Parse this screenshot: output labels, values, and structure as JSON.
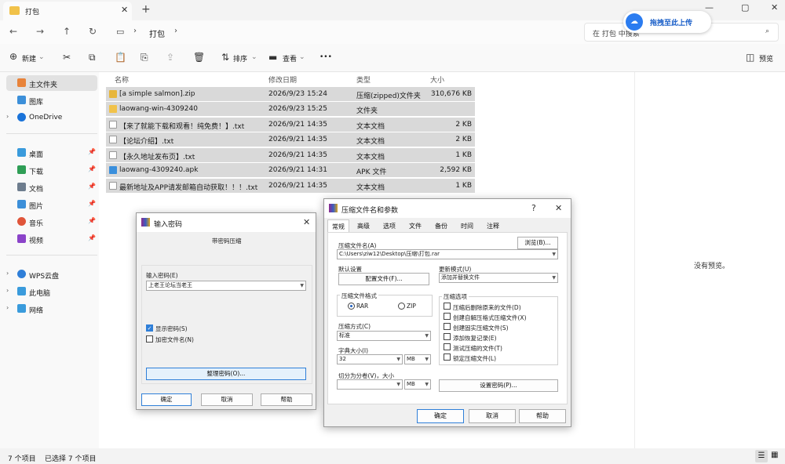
{
  "window": {
    "tab_title": "打包",
    "close_tab": "✕",
    "new_tab": "+",
    "minimize": "—",
    "maximize": "▢",
    "close": "✕"
  },
  "address": {
    "path": "打包",
    "search_placeholder": "在 打包 中搜索"
  },
  "upload": {
    "label": "拖拽至此上传"
  },
  "toolbar": {
    "new": "新建",
    "sort": "排序",
    "view": "查看",
    "more": "•••",
    "preview": "预览"
  },
  "sidebar": {
    "items": [
      {
        "label": "主文件夹",
        "color": "#e8833a"
      },
      {
        "label": "图库",
        "color": "#3c8fd9"
      },
      {
        "label": "OneDrive",
        "color": "#1a73d9"
      },
      {
        "label": "桌面",
        "color": "#3a9bdc"
      },
      {
        "label": "下载",
        "color": "#2f9e56"
      },
      {
        "label": "文档",
        "color": "#6e7d8e"
      },
      {
        "label": "图片",
        "color": "#3c8fd9"
      },
      {
        "label": "音乐",
        "color": "#e0553a"
      },
      {
        "label": "视频",
        "color": "#8b43c9"
      },
      {
        "label": "WPS云盘",
        "color": "#2f7fd8"
      },
      {
        "label": "此电脑",
        "color": "#3a9bdc"
      },
      {
        "label": "网络",
        "color": "#3a9bdc"
      }
    ]
  },
  "columns": {
    "name": "名称",
    "date": "修改日期",
    "type": "类型",
    "size": "大小"
  },
  "files": [
    {
      "name": "[a simple salmon].zip",
      "date": "2026/9/23 15:24",
      "type": "压缩(zipped)文件夹",
      "size": "310,676 KB",
      "color": "#e7b63b"
    },
    {
      "name": "laowang-win-4309240",
      "date": "2026/9/23 15:25",
      "type": "文件夹",
      "size": "",
      "color": "#f1c24a"
    },
    {
      "name": "【来了就能下载和观看！纯免费！】.txt",
      "date": "2026/9/21 14:35",
      "type": "文本文档",
      "size": "2 KB",
      "color": "#ffffff"
    },
    {
      "name": "【论坛介绍】.txt",
      "date": "2026/9/21 14:35",
      "type": "文本文档",
      "size": "2 KB",
      "color": "#ffffff"
    },
    {
      "name": "【永久地址发布页】.txt",
      "date": "2026/9/21 14:35",
      "type": "文本文档",
      "size": "1 KB",
      "color": "#ffffff"
    },
    {
      "name": "laowang-4309240.apk",
      "date": "2026/9/21 14:31",
      "type": "APK 文件",
      "size": "2,592 KB",
      "color": "#3a8fdc"
    },
    {
      "name": "最新地址及APP请发邮箱自动获取！！！.txt",
      "date": "2026/9/21 14:35",
      "type": "文本文档",
      "size": "1 KB",
      "color": "#ffffff"
    }
  ],
  "preview": {
    "empty": "没有预览。"
  },
  "status": {
    "count": "7 个项目",
    "selected": "已选择 7 个项目"
  },
  "pwd_dialog": {
    "title": "输入密码",
    "subtitle": "带密码压缩",
    "input_label": "输入密码(E)",
    "input_value": "上老王论坛当老王",
    "show_pwd": "显示密码(S)",
    "encrypt_names": "加密文件名(N)",
    "organize": "整理密码(O)...",
    "ok": "确定",
    "cancel": "取消",
    "help": "帮助"
  },
  "rar_dialog": {
    "title": "压缩文件名和参数",
    "help_q": "?",
    "tabs": [
      "常规",
      "高级",
      "选项",
      "文件",
      "备份",
      "时间",
      "注释"
    ],
    "archive_label": "压缩文件名(A)",
    "browse": "浏览(B)...",
    "archive_value": "C:\\Users\\ziw12\\Desktop\\压缩\\打包.rar",
    "default_label": "默认设置",
    "profile_btn": "配置文件(F)...",
    "update_label": "更新模式(U)",
    "update_value": "添加并替换文件",
    "format_label": "压缩文件格式",
    "rar": "RAR",
    "zip": "ZIP",
    "method_label": "压缩方式(C)",
    "method_value": "标准",
    "dict_label": "字典大小(I)",
    "dict_value": "32",
    "dict_unit": "MB",
    "split_label": "切分为分卷(V)，大小",
    "split_unit": "MB",
    "options_label": "压缩选项",
    "options": [
      "压缩后删除原来的文件(D)",
      "创建自解压格式压缩文件(X)",
      "创建固实压缩文件(S)",
      "添加恢复记录(E)",
      "测试压缩的文件(T)",
      "锁定压缩文件(L)"
    ],
    "set_pwd": "设置密码(P)...",
    "ok": "确定",
    "cancel": "取消",
    "help": "帮助"
  }
}
